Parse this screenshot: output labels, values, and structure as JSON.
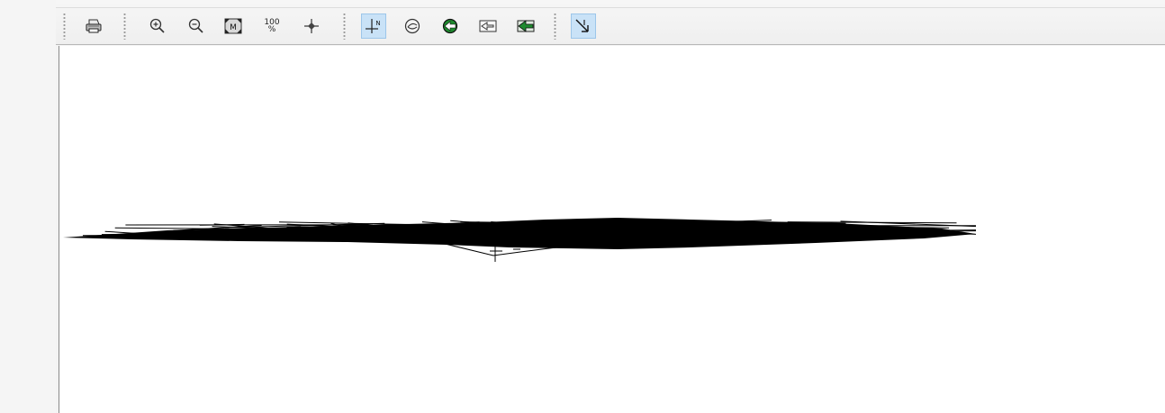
{
  "toolbar": {
    "buttons": [
      {
        "id": "print",
        "icon": "printer-icon",
        "active": false
      },
      {
        "id": "zoom-in",
        "icon": "zoom-in-icon",
        "active": false
      },
      {
        "id": "zoom-out",
        "icon": "zoom-out-icon",
        "active": false
      },
      {
        "id": "zoom-extents",
        "icon": "zoom-extents-icon",
        "label": "M",
        "active": false
      },
      {
        "id": "zoom-100",
        "icon": "zoom-100-percent-icon",
        "label_top": "100",
        "label_bottom": "%",
        "active": false
      },
      {
        "id": "pan",
        "icon": "crosshair-icon",
        "active": false
      },
      {
        "id": "north-arrow",
        "icon": "north-axis-icon",
        "label": "N",
        "active": true
      },
      {
        "id": "rotate",
        "icon": "rotate-view-icon",
        "active": false
      },
      {
        "id": "green-nav",
        "icon": "green-navigate-icon",
        "active": false
      },
      {
        "id": "outline-shape",
        "icon": "outline-shape-icon",
        "active": false
      },
      {
        "id": "green-shape",
        "icon": "green-shape-icon",
        "active": false
      },
      {
        "id": "direction",
        "icon": "direction-arrow-icon",
        "active": true
      }
    ]
  },
  "colors": {
    "active_bg": "#c9e2f7",
    "active_border": "#9cc6ea",
    "canvas_bg": "#ffffff",
    "drawing": "#000000",
    "green_icon": "#1e8a2e"
  }
}
